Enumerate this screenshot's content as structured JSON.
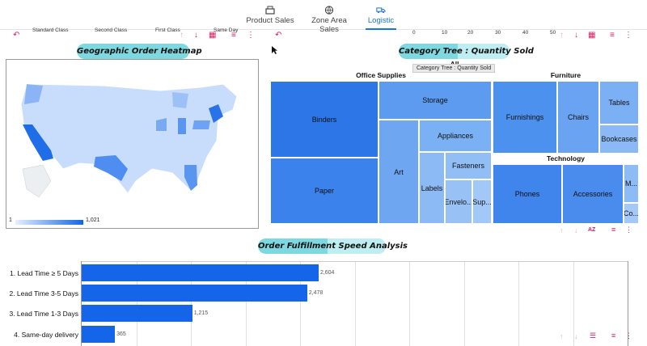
{
  "tabs": [
    {
      "label": "Product Sales",
      "icon": "cash-register-icon",
      "active": false
    },
    {
      "label": "Zone Area Sales",
      "icon": "globe-icon",
      "active": false
    },
    {
      "label": "Logistic",
      "icon": "truck-icon",
      "active": true
    }
  ],
  "residue": {
    "standard_class": "Standard Class",
    "second_class": "Second Class",
    "first_class": "First Class",
    "same_day": "Same Day",
    "axis_ticks": [
      "0",
      "10",
      "20",
      "30",
      "40",
      "50"
    ]
  },
  "map_panel": {
    "title": "Geographic Order Heatmap",
    "legend_min": "1",
    "legend_max": "1,021"
  },
  "treemap_panel": {
    "title_left": "Category Tree :",
    "title_right": "Quantity Sold",
    "tooltip": "Category Tree : Quantity Sold",
    "root_label": "All",
    "groups": {
      "office": "Office Supplies",
      "furniture": "Furniture",
      "technology": "Technology"
    },
    "cells": {
      "binders": "Binders",
      "paper": "Paper",
      "storage": "Storage",
      "art": "Art",
      "appliances": "Appliances",
      "labels": "Labels",
      "fasteners": "Fasteners",
      "envelopes": "Envelo...",
      "supplies": "Sup...",
      "furnishings": "Furnishings",
      "chairs": "Chairs",
      "tables": "Tables",
      "bookcases": "Bookcases",
      "phones": "Phones",
      "accessories": "Accessories",
      "machines": "M...",
      "copiers": "Co..."
    },
    "az_label": "AZ"
  },
  "bar_panel": {
    "title_left": "Order Fulfillment",
    "title_right": "Speed Analysis"
  },
  "chart_data": {
    "type": "bar",
    "orientation": "horizontal",
    "categories": [
      "1. Lead Time ≥ 5 Days",
      "2. Lead Time 3-5 Days",
      "3. Lead Time 1-3 Days",
      "4. Same-day delivery"
    ],
    "values": [
      2604,
      2478,
      1215,
      365
    ],
    "value_labels": [
      "2,604",
      "2,478",
      "1,215",
      "365"
    ],
    "title": "",
    "xlabel": "",
    "ylabel": "",
    "grid": true
  },
  "colors": {
    "accent": "#1a73e8",
    "bar": "#1565e8",
    "pill": "#7dd8e0",
    "toolbar": "#d81b60"
  }
}
